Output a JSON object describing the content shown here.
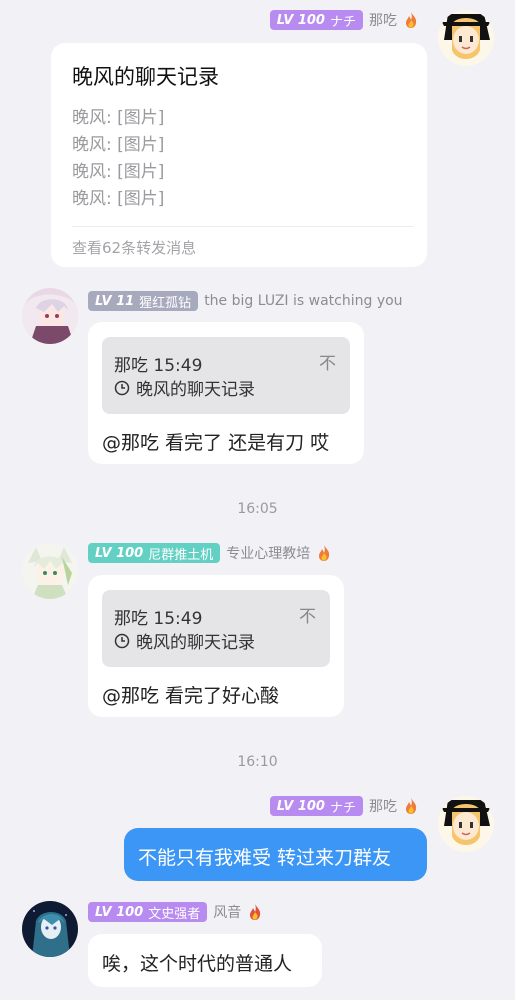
{
  "messages": [
    {
      "sender": "那吃",
      "level": "LV 100",
      "title": "ナチ",
      "forward": {
        "title": "晚风的聊天记录",
        "lines": [
          "晚风: [图片]",
          "晚风: [图片]",
          "晚风: [图片]",
          "晚风: [图片]"
        ],
        "footer": "查看62条转发消息"
      }
    },
    {
      "sender": "the big LUZI is watching you",
      "level": "LV 11",
      "title": "猩红孤钻",
      "quote": {
        "author_time": "那吃 15:49",
        "content": "晚风的聊天记录",
        "mark": "不"
      },
      "text": "@那吃 看完了 还是有刀 哎"
    },
    {
      "timestamp": "16:05"
    },
    {
      "sender": "专业心理教培",
      "level": "LV 100",
      "title": "尼群推土机",
      "quote": {
        "author_time": "那吃 15:49",
        "content": "晚风的聊天记录",
        "mark": "不"
      },
      "text": "@那吃 看完了好心酸"
    },
    {
      "timestamp": "16:10"
    },
    {
      "sender": "那吃",
      "level": "LV 100",
      "title": "ナチ",
      "text": "不能只有我难受 转过来刀群友"
    },
    {
      "sender": "风音",
      "level": "LV 100",
      "title": "文史强者",
      "text": "唉，这个时代的普通人"
    }
  ],
  "colors": {
    "background": "#f2f1f6",
    "self_bubble": "#3c96f5",
    "badge_purple": "#b88bf0",
    "badge_gray": "#a7a9bd",
    "badge_teal": "#63d0c4"
  },
  "icons": [
    "fire-icon",
    "clock-icon",
    "avatar-image"
  ]
}
